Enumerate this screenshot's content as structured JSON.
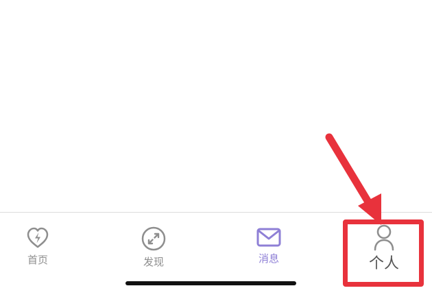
{
  "tabbar": {
    "items": [
      {
        "id": "home",
        "label": "首页",
        "icon": "heart-bolt-icon",
        "active": false
      },
      {
        "id": "discover",
        "label": "发现",
        "icon": "compass-icon",
        "active": false
      },
      {
        "id": "messages",
        "label": "消息",
        "icon": "envelope-icon",
        "active": true
      },
      {
        "id": "profile",
        "label": "个人",
        "icon": "person-icon",
        "active": false,
        "highlighted": true
      }
    ]
  },
  "colors": {
    "inactive": "#8e8e8e",
    "active": "#8e7fd6",
    "annotation": "#e8323c",
    "divider": "#dcdcdc"
  }
}
